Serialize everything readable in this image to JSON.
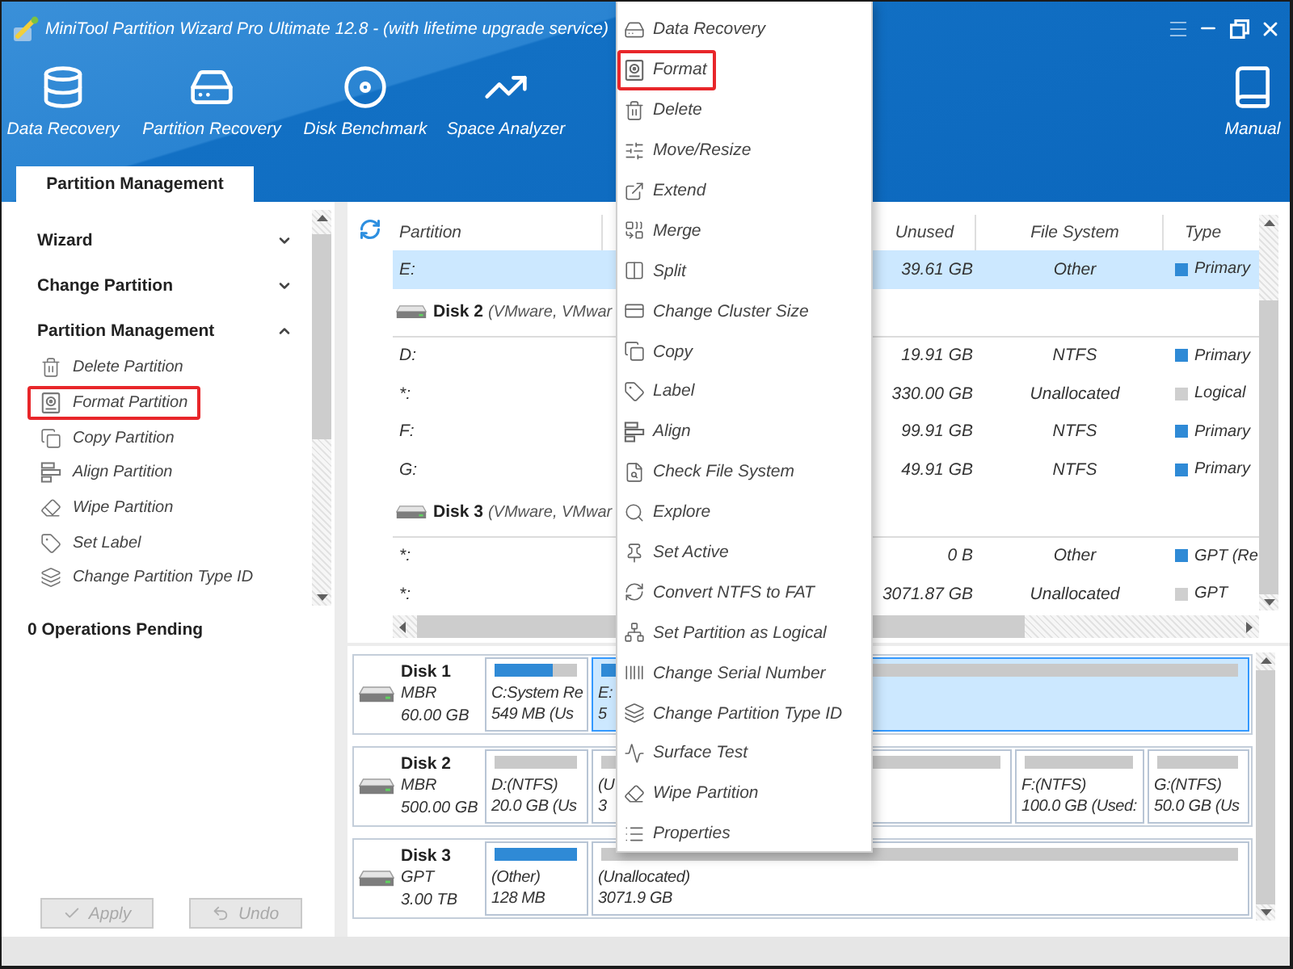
{
  "window": {
    "title": "MiniTool Partition Wizard Pro Ultimate 12.8 - (with lifetime upgrade service)"
  },
  "toolbar": {
    "items": [
      {
        "label": "Data Recovery"
      },
      {
        "label": "Partition Recovery"
      },
      {
        "label": "Disk Benchmark"
      },
      {
        "label": "Space Analyzer"
      }
    ],
    "manual": {
      "label": "Manual"
    }
  },
  "tabs": [
    {
      "label": "Partition Management",
      "selected": true
    }
  ],
  "sidebar": {
    "sections": [
      {
        "title": "Wizard",
        "expanded": false
      },
      {
        "title": "Change Partition",
        "expanded": false
      },
      {
        "title": "Partition Management",
        "expanded": true,
        "items": [
          {
            "label": "Delete Partition",
            "highlighted": false
          },
          {
            "label": "Format Partition",
            "highlighted": true
          },
          {
            "label": "Copy Partition",
            "highlighted": false
          },
          {
            "label": "Align Partition",
            "highlighted": false
          },
          {
            "label": "Wipe Partition",
            "highlighted": false
          },
          {
            "label": "Set Label",
            "highlighted": false
          },
          {
            "label": "Change Partition Type ID",
            "highlighted": false
          }
        ]
      }
    ],
    "pending": "0 Operations Pending",
    "buttons": [
      {
        "label": "Apply",
        "disabled": true
      },
      {
        "label": "Undo",
        "disabled": true
      }
    ]
  },
  "table": {
    "columns": [
      "Partition",
      "Unused",
      "File System",
      "Type"
    ],
    "rows": [
      {
        "kind": "partition",
        "partition": "E:",
        "unused": "39.61 GB",
        "file_system": "Other",
        "type": "Primary",
        "color": "#2f8ad6",
        "selected": true
      },
      {
        "kind": "disk",
        "name": "Disk 2",
        "detail": "(VMware, VMwar"
      },
      {
        "kind": "partition",
        "partition": "D:",
        "unused": "19.91 GB",
        "file_system": "NTFS",
        "type": "Primary",
        "color": "#2f8ad6",
        "selected": false
      },
      {
        "kind": "partition",
        "partition": "*:",
        "unused": "330.00 GB",
        "file_system": "Unallocated",
        "type": "Logical",
        "color": "#cfcfcf",
        "selected": false
      },
      {
        "kind": "partition",
        "partition": "F:",
        "unused": "99.91 GB",
        "file_system": "NTFS",
        "type": "Primary",
        "color": "#2f8ad6",
        "selected": false
      },
      {
        "kind": "partition",
        "partition": "G:",
        "unused": "49.91 GB",
        "file_system": "NTFS",
        "type": "Primary",
        "color": "#2f8ad6",
        "selected": false
      },
      {
        "kind": "disk",
        "name": "Disk 3",
        "detail": "(VMware, VMwar"
      },
      {
        "kind": "partition",
        "partition": "*:",
        "unused": "0 B",
        "file_system": "Other",
        "type": "GPT (Re",
        "color": "#2f8ad6",
        "selected": false
      },
      {
        "kind": "partition",
        "partition": "*:",
        "unused": "3071.87 GB",
        "file_system": "Unallocated",
        "type": "GPT",
        "color": "#cfcfcf",
        "selected": false
      }
    ]
  },
  "disk_map": {
    "disks": [
      {
        "name": "Disk 1",
        "scheme": "MBR",
        "size": "60.00 GB",
        "partitions": [
          {
            "label": "C:System Re",
            "size": "549 MB (Us",
            "level": 0.7,
            "selected": false
          },
          {
            "label": "E:",
            "size": "5",
            "level": 0.34,
            "selected": true
          }
        ]
      },
      {
        "name": "Disk 2",
        "scheme": "MBR",
        "size": "500.00 GB",
        "partitions": [
          {
            "label": "D:(NTFS)",
            "size": "20.0 GB (Us",
            "level": 0,
            "selected": false
          },
          {
            "label": "(U",
            "size": "3",
            "level": 0,
            "selected": false
          },
          {
            "label": "F:(NTFS)",
            "size": "100.0 GB (Used:",
            "level": 0,
            "selected": false
          },
          {
            "label": "G:(NTFS)",
            "size": "50.0 GB (Us",
            "level": 0,
            "selected": false
          }
        ]
      },
      {
        "name": "Disk 3",
        "scheme": "GPT",
        "size": "3.00 TB",
        "partitions": [
          {
            "label": "(Other)",
            "size": "128 MB",
            "level": 1,
            "selected": false
          },
          {
            "label": "(Unallocated)",
            "size": "3071.9 GB",
            "level": 0,
            "selected": false
          }
        ]
      }
    ]
  },
  "context_menu": {
    "items": [
      {
        "label": "Data Recovery",
        "highlighted": false
      },
      {
        "label": "Format",
        "highlighted": true
      },
      {
        "label": "Delete",
        "highlighted": false
      },
      {
        "label": "Move/Resize",
        "highlighted": false
      },
      {
        "label": "Extend",
        "highlighted": false
      },
      {
        "label": "Merge",
        "highlighted": false
      },
      {
        "label": "Split",
        "highlighted": false
      },
      {
        "label": "Change Cluster Size",
        "highlighted": false
      },
      {
        "label": "Copy",
        "highlighted": false
      },
      {
        "label": "Label",
        "highlighted": false
      },
      {
        "label": "Align",
        "highlighted": false
      },
      {
        "label": "Check File System",
        "highlighted": false
      },
      {
        "label": "Explore",
        "highlighted": false
      },
      {
        "label": "Set Active",
        "highlighted": false
      },
      {
        "label": "Convert NTFS to FAT",
        "highlighted": false
      },
      {
        "label": "Set Partition as Logical",
        "highlighted": false
      },
      {
        "label": "Change Serial Number",
        "highlighted": false
      },
      {
        "label": "Change Partition Type ID",
        "highlighted": false
      },
      {
        "label": "Surface Test",
        "highlighted": false
      },
      {
        "label": "Wipe Partition",
        "highlighted": false
      },
      {
        "label": "Properties",
        "highlighted": false
      }
    ]
  }
}
